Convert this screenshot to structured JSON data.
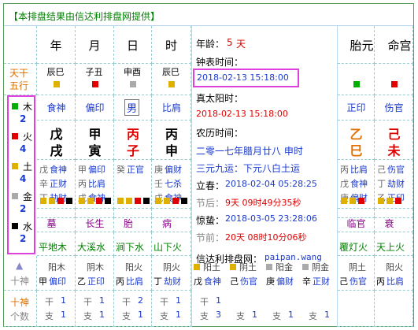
{
  "header": "【本排盘结果由信达利排盘网提供】",
  "cols": [
    "年",
    "月",
    "日",
    "时"
  ],
  "side_cols": [
    "胎元",
    "命宫"
  ],
  "tiangan_label": [
    "天干",
    "五行"
  ],
  "heads": [
    "辰巳",
    "子丑",
    "申酉",
    "辰巳"
  ],
  "heads_side": [
    "胎元",
    "命宫"
  ],
  "shishen_row": [
    "食神",
    "偏印",
    "男",
    "比肩"
  ],
  "shishen_side": [
    "正印",
    "伤官"
  ],
  "wuxing": [
    {
      "label": "木",
      "count": "2",
      "color": "#00b000"
    },
    {
      "label": "火",
      "count": "4",
      "color": "#e00000"
    },
    {
      "label": "土",
      "count": "4",
      "color": "#e0b000"
    },
    {
      "label": "金",
      "count": "2",
      "color": "#aaaaaa"
    },
    {
      "label": "水",
      "count": "2",
      "color": "#000000"
    }
  ],
  "gan": [
    "戊",
    "甲",
    "丙",
    "丙"
  ],
  "zhi": [
    "戌",
    "寅",
    "子",
    "申"
  ],
  "gan_side": [
    "乙",
    "己"
  ],
  "zhi_side": [
    "巳",
    "未"
  ],
  "canggan": [
    [
      [
        "戊",
        "食神"
      ],
      [
        "辛",
        "正财"
      ],
      [
        "丁",
        "劫财"
      ]
    ],
    [
      [
        "甲",
        "偏印"
      ],
      [
        "丙",
        "比肩"
      ],
      [
        "戊",
        "食神"
      ]
    ],
    [
      [
        "癸",
        "正官"
      ]
    ],
    [
      [
        "庚",
        "偏财"
      ],
      [
        "壬",
        "七杀"
      ],
      [
        "戊",
        "食神"
      ]
    ]
  ],
  "canggan_side": [
    [
      [
        "丙",
        "比肩"
      ],
      [
        "戊",
        "食神"
      ],
      [
        "庚",
        "偏财"
      ]
    ],
    [
      [
        "己",
        "伤官"
      ],
      [
        "丁",
        "劫财"
      ],
      [
        "乙",
        "正印"
      ]
    ]
  ],
  "shensha": [
    "墓",
    "长生",
    "胎",
    "病"
  ],
  "shensha_side": [
    "临官",
    "衰"
  ],
  "nayin": [
    "平地木",
    "大溪水",
    "涧下水",
    "山下火"
  ],
  "nayin_side": [
    "覆灯火",
    "天上火"
  ],
  "dayun_label": "十神",
  "dayun": [
    [
      "阳木",
      "甲",
      "偏印"
    ],
    [
      "阴木",
      "乙",
      "正印"
    ],
    [
      "阳火",
      "丙",
      "比肩"
    ],
    [
      "阴火",
      "丁",
      "劫财"
    ]
  ],
  "dayun_side": [
    [
      "阴土",
      "己",
      "伤官"
    ],
    [
      "阳火",
      "丙",
      "比肩"
    ]
  ],
  "count_label": [
    "十神",
    "个数"
  ],
  "counts": [
    [
      "干",
      "1"
    ],
    [
      "支",
      "1"
    ]
  ],
  "counts_vals": [
    [
      [
        "干",
        "1"
      ],
      [
        "支",
        "1"
      ]
    ],
    [
      [
        "干",
        "1"
      ],
      [
        "支",
        "1"
      ]
    ],
    [
      [
        "干",
        "2"
      ],
      [
        "支",
        "1"
      ]
    ],
    [
      [
        "干",
        "1"
      ],
      [
        "支",
        "1"
      ]
    ]
  ],
  "mid": {
    "age_label": "年龄：",
    "age": "5",
    "age_unit": "天",
    "clock_label": "钟表时间：",
    "clock": "2018-02-13 15:18:00",
    "solar_label": "真太阳时：",
    "solar": "2018-02-13 15:18:00",
    "lunar_label": "农历时间：",
    "lunar": "二零一七年腊月廿八 申时",
    "sanyuan": "三元九运：下元八白土运",
    "lichun_label": "立春：",
    "lichun": "2018-02-04 05:28:25",
    "jiehou_label": "节后：",
    "jiehou": "9天 09时49分35秒",
    "jingzhe_label": "惊蛰：",
    "jingzhe": "2018-03-05 23:28:06",
    "jieqian_label": "节前：",
    "jieqian": "20天 08时10分06秒",
    "site_label": "信达利排盘网：",
    "site": "paipan.wang",
    "dayun_mid": [
      [
        "阳土",
        "戊",
        "食神"
      ],
      [
        "阴土",
        "己",
        "伤官"
      ],
      [
        "阳金",
        "庚",
        "偏财"
      ],
      [
        "阴金",
        "辛",
        "正财"
      ]
    ],
    "counts_mid": [
      [
        [
          "干",
          "1"
        ],
        [
          "支",
          "3"
        ]
      ],
      [
        [
          "支",
          "1"
        ]
      ],
      [
        [
          "支",
          "1"
        ]
      ],
      [
        [
          "支",
          "1"
        ]
      ]
    ]
  }
}
